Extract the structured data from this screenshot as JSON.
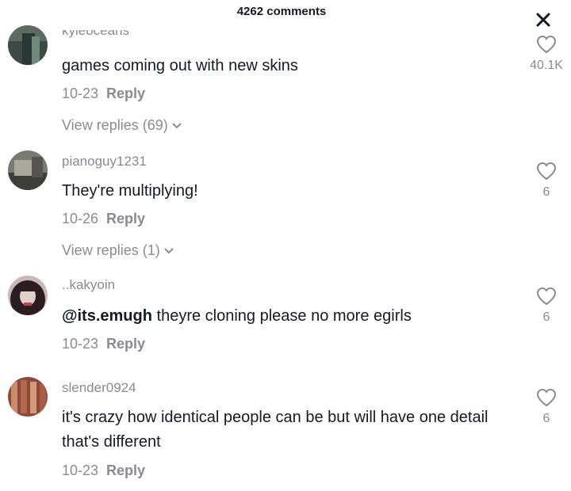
{
  "header": {
    "title": "4262 comments",
    "close_icon": "close-icon"
  },
  "comments": [
    {
      "username": "kyleoceans",
      "text": "games coming out with new skins",
      "date": "10-23",
      "reply_label": "Reply",
      "view_replies": "View replies (69)",
      "likes": "40.1K"
    },
    {
      "username": "pianoguy1231",
      "text": "They're multiplying!",
      "date": "10-26",
      "reply_label": "Reply",
      "view_replies": "View replies (1)",
      "likes": "6"
    },
    {
      "username": "..kakyoin",
      "mention": "@its.emugh",
      "text": " theyre cloning please no more egirls",
      "date": "10-23",
      "reply_label": "Reply",
      "likes": "6"
    },
    {
      "username": "slender0924",
      "text": "it's crazy how identical people can be but will have one detail that's different",
      "date": "10-23",
      "reply_label": "Reply",
      "likes": "6"
    }
  ],
  "colors": {
    "text": "#161823",
    "muted": "#8a8b91",
    "background": "#ffffff"
  }
}
